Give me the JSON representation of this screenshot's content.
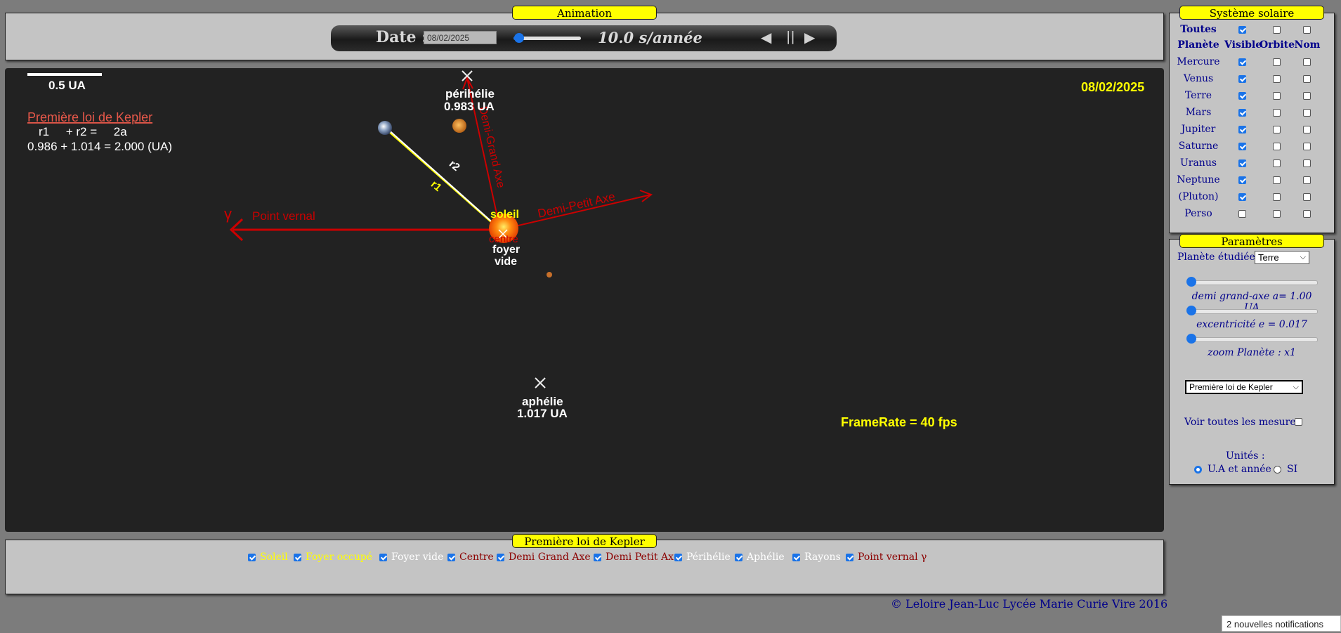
{
  "animation": {
    "title": "Animation",
    "date_label": "Date :",
    "date_value": "08/02/2025",
    "speed_label": "10.0 s/année",
    "speed_slider_fraction": 0.08,
    "prev_icon": "◀",
    "pause_icon": "||",
    "next_icon": "▶"
  },
  "canvas": {
    "scale_label": "0.5 UA",
    "date": "08/02/2025",
    "framerate": "FrameRate = 40 fps",
    "kepler_title": "Première loi de Kepler",
    "kepler_formula_1": "r1     + r2 =     2a",
    "kepler_formula_2": "0.986 + 1.014  = 2.000 (UA)",
    "perihelie_label": "périhélie",
    "perihelie_value": "0.983 UA",
    "aphelie_label": "aphélie",
    "aphelie_value": "1.017 UA",
    "soleil_label": "soleil",
    "centre_label": "centre",
    "foyer_vide_label_1": "foyer",
    "foyer_vide_label_2": "vide",
    "point_vernal_label": "Point vernal",
    "gamma_label": "γ",
    "demi_grand_axe_label": "Demi-Grand Axe",
    "demi_petit_axe_label": "Demi-Petit Axe",
    "r1_label": "r1",
    "r2_label": "r2"
  },
  "solar_system": {
    "title": "Système solaire",
    "toutes_label": "Toutes",
    "headers": {
      "planete": "Planète",
      "visible": "Visible",
      "orbite": "Orbite",
      "nom": "Nom"
    },
    "toutes": {
      "visible": true,
      "orbite": false,
      "nom": false
    },
    "planets": [
      {
        "name": "Mercure",
        "visible": true,
        "orbite": false,
        "nom": false
      },
      {
        "name": "Venus",
        "visible": true,
        "orbite": false,
        "nom": false
      },
      {
        "name": "Terre",
        "visible": true,
        "orbite": false,
        "nom": false
      },
      {
        "name": "Mars",
        "visible": true,
        "orbite": false,
        "nom": false
      },
      {
        "name": "Jupiter",
        "visible": true,
        "orbite": false,
        "nom": false
      },
      {
        "name": "Saturne",
        "visible": true,
        "orbite": false,
        "nom": false
      },
      {
        "name": "Uranus",
        "visible": true,
        "orbite": false,
        "nom": false
      },
      {
        "name": "Neptune",
        "visible": true,
        "orbite": false,
        "nom": false
      },
      {
        "name": "(Pluton)",
        "visible": true,
        "orbite": false,
        "nom": false
      },
      {
        "name": "Perso",
        "visible": false,
        "orbite": false,
        "nom": false
      }
    ]
  },
  "parameters": {
    "title": "Paramètres",
    "planet_label": "Planète étudiée :",
    "planet_value": "Terre",
    "demi_grand_axe": "demi grand-axe a= 1.00 UA",
    "excentricite": "excentricité e = 0.017",
    "zoom": "zoom Planète : x1",
    "mode_value": "Première loi de Kepler",
    "voir_mesures": "Voir toutes les mesures",
    "voir_mesures_checked": false,
    "unites_label": "Unités :",
    "unit_ua": "U.A et année",
    "unit_si": "SI",
    "unit_selected": "ua"
  },
  "legend": {
    "title": "Première loi de Kepler",
    "items": [
      {
        "label": "Soleil",
        "color": "#ffff00",
        "checked": true
      },
      {
        "label": "Foyer occupé",
        "color": "#ffff00",
        "checked": true
      },
      {
        "label": "Foyer vide",
        "color": "#ffffff",
        "checked": true
      },
      {
        "label": "Centre",
        "color": "#8b0000",
        "checked": true
      },
      {
        "label": "Demi Grand Axe",
        "color": "#8b0000",
        "checked": true
      },
      {
        "label": "Demi Petit Axe",
        "color": "#8b0000",
        "checked": true
      },
      {
        "label": "Périhélie",
        "color": "#ffffff",
        "checked": true
      },
      {
        "label": "Aphélie",
        "color": "#ffffff",
        "checked": true
      },
      {
        "label": "Rayons",
        "color": "#ffffff",
        "checked": true
      },
      {
        "label": "Point vernal γ",
        "color": "#8b0000",
        "checked": true
      }
    ]
  },
  "footer": {
    "copyright": "© Leloire Jean-Luc Lycée Marie Curie Vire 2016",
    "notification": "2 nouvelles notifications"
  }
}
